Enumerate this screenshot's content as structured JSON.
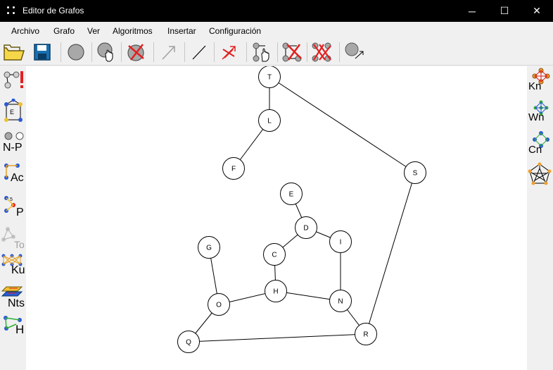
{
  "window": {
    "title": "Editor de Grafos",
    "minimize": "─",
    "maximize": "☐",
    "close": "✕"
  },
  "menu": [
    "Archivo",
    "Grafo",
    "Ver",
    "Algoritmos",
    "Insertar",
    "Configuración"
  ],
  "toolbar": [
    "open-folder",
    "save-disk",
    "add-vertex",
    "move-vertex",
    "delete-vertex",
    "add-directed-edge",
    "add-edge",
    "delete-edge",
    "select-hand",
    "delete-selection",
    "clear-all",
    "vertex-arrow"
  ],
  "left_tools": [
    {
      "icon": "graph-warning-icon",
      "label": ""
    },
    {
      "icon": "edge-cycle-icon",
      "label": ""
    },
    {
      "icon": "np-icon",
      "label": "N-P"
    },
    {
      "icon": "ac-icon",
      "label": "Ac"
    },
    {
      "icon": "p-icon",
      "label": "P"
    },
    {
      "icon": "to-icon",
      "label": "To"
    },
    {
      "icon": "ku-icon",
      "label": "Ku"
    },
    {
      "icon": "nts-icon",
      "label": "Nts"
    },
    {
      "icon": "h-icon",
      "label": "H"
    }
  ],
  "right_tools": [
    {
      "icon": "kn-icon",
      "label": "Kn"
    },
    {
      "icon": "wn-icon",
      "label": "Wn"
    },
    {
      "icon": "cn-icon",
      "label": "Cn"
    },
    {
      "icon": "petersen-icon",
      "label": ""
    }
  ],
  "graph": {
    "vertices": [
      {
        "id": "T",
        "label": "T"
      },
      {
        "id": "L",
        "label": "L"
      },
      {
        "id": "F",
        "label": "F"
      },
      {
        "id": "S",
        "label": "S"
      },
      {
        "id": "E",
        "label": "E"
      },
      {
        "id": "D",
        "label": "D"
      },
      {
        "id": "I",
        "label": "I"
      },
      {
        "id": "G",
        "label": "G"
      },
      {
        "id": "C",
        "label": "C"
      },
      {
        "id": "H",
        "label": "H"
      },
      {
        "id": "N",
        "label": "N"
      },
      {
        "id": "O",
        "label": "O"
      },
      {
        "id": "R",
        "label": "R"
      },
      {
        "id": "Q",
        "label": "Q"
      }
    ],
    "edges": [
      [
        "T",
        "L"
      ],
      [
        "L",
        "F"
      ],
      [
        "T",
        "S"
      ],
      [
        "S",
        "R"
      ],
      [
        "E",
        "D"
      ],
      [
        "D",
        "C"
      ],
      [
        "D",
        "I"
      ],
      [
        "C",
        "H"
      ],
      [
        "I",
        "N"
      ],
      [
        "H",
        "N"
      ],
      [
        "H",
        "O"
      ],
      [
        "G",
        "O"
      ],
      [
        "O",
        "Q"
      ],
      [
        "Q",
        "R"
      ],
      [
        "N",
        "R"
      ]
    ]
  }
}
